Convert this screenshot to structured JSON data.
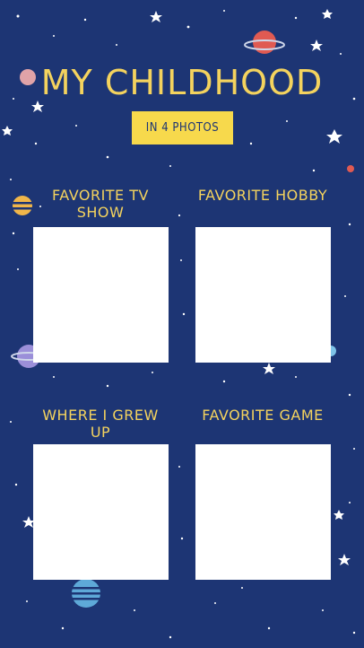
{
  "title": "MY CHILDHOOD",
  "subtitle": "IN 4 PHOTOS",
  "slots": [
    {
      "label": "FAVORITE TV SHOW"
    },
    {
      "label": "FAVORITE HOBBY"
    },
    {
      "label": "WHERE I GREW UP"
    },
    {
      "label": "FAVORITE GAME"
    }
  ],
  "colors": {
    "background": "#1d3574",
    "accent": "#f4d35e",
    "photo_frame": "#ffffff"
  },
  "icons": [
    "planet-ringed-icon",
    "planet-striped-icon",
    "star-icon"
  ]
}
